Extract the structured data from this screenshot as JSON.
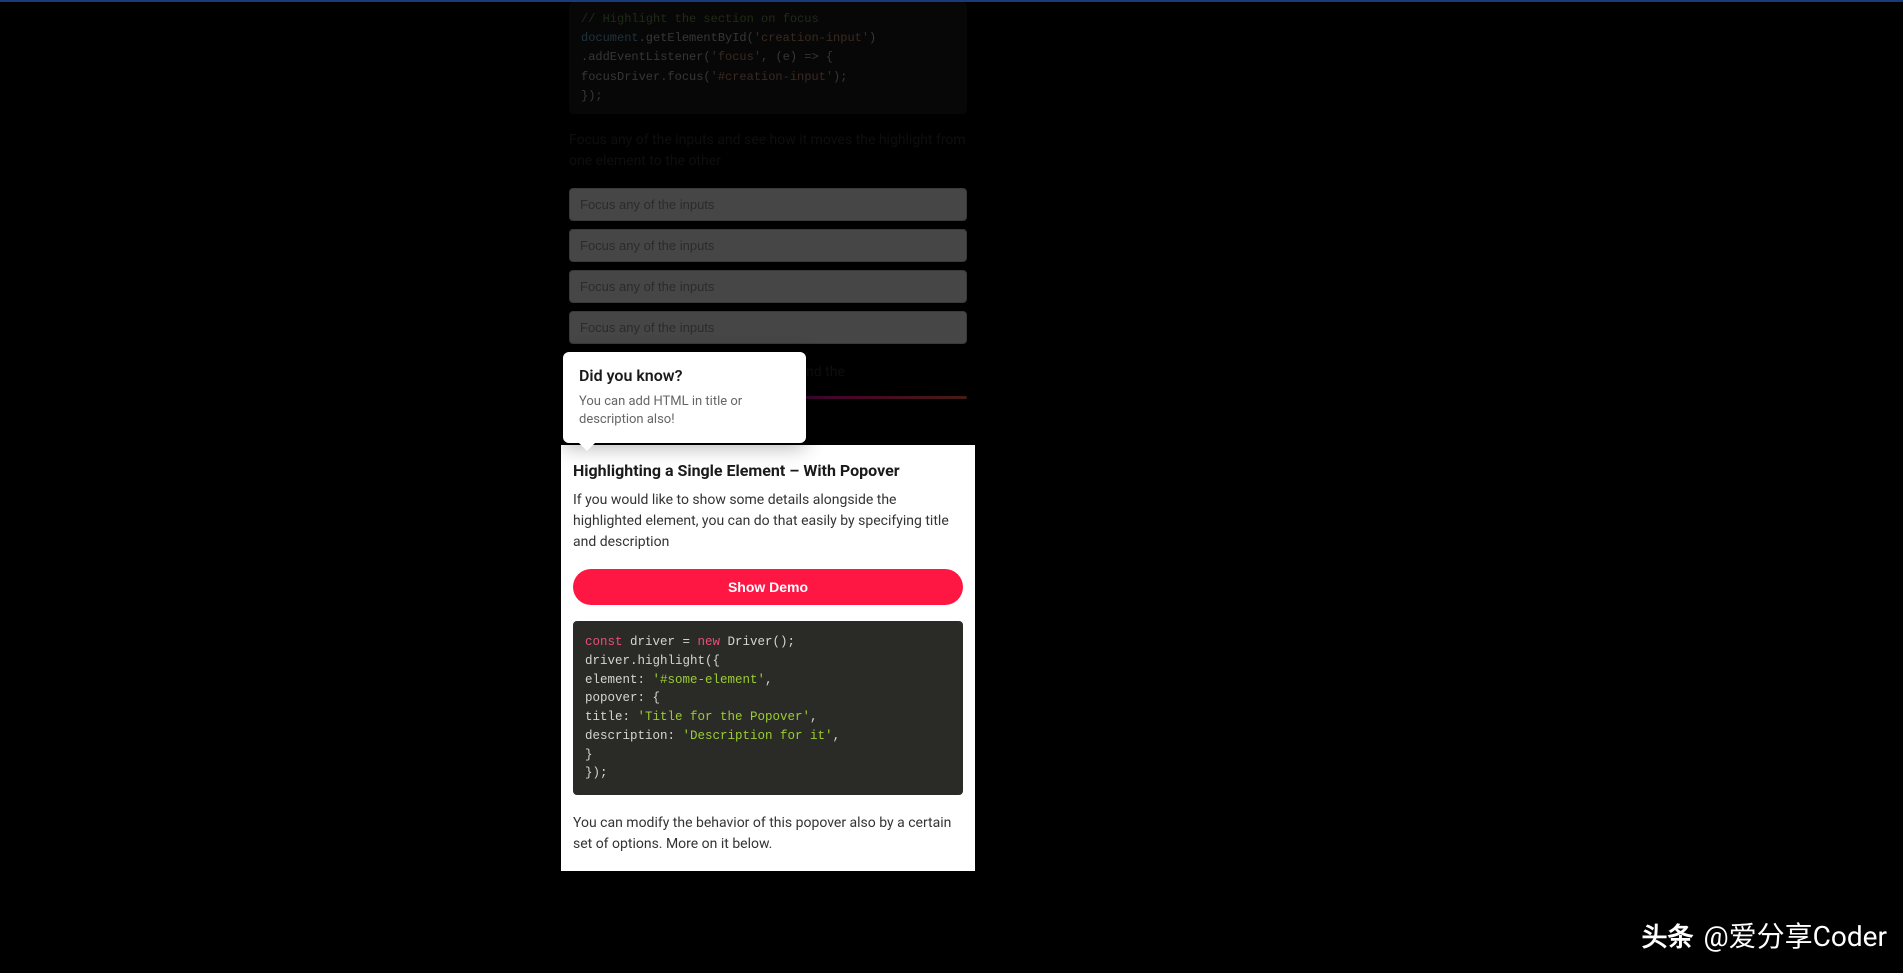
{
  "code_top": {
    "comment": "// Highlight the section on focus",
    "line1_part1": "document",
    "line1_part2": ".getElementById(",
    "line1_str": "'creation-input'",
    "line1_part3": ")",
    "line2_part1": "  .addEventListener(",
    "line2_str": "'focus'",
    "line2_part2": ", (e) => {",
    "line3_part1": "    focusDriver.focus(",
    "line3_str": "'#creation-input'",
    "line3_part2": ");",
    "line4": "  });"
  },
  "focus_description": "Focus any of the inputs and see how it moves the highlight from one element to the other",
  "input_placeholder": "Focus any of the inputs",
  "padding_note": "the padding around the",
  "popover": {
    "title": "Did you know?",
    "description": "You can add HTML in title or description also!"
  },
  "highlighted": {
    "heading": "Highlighting a Single Element – With Popover",
    "description": "If you would like to show some details alongside the highlighted element, you can do that easily by specifying title and description",
    "button_label": "Show Demo",
    "code": {
      "l1_const": "const",
      "l1_rest": " driver = ",
      "l1_new": "new",
      "l1_end": " Driver();",
      "l2": "driver.highlight({",
      "l3_key": "  element: ",
      "l3_str": "'#some-element'",
      "l3_end": ",",
      "l4": "  popover: {",
      "l5_key": "    title: ",
      "l5_str": "'Title for the Popover'",
      "l5_end": ",",
      "l6_key": "    description: ",
      "l6_str": "'Description for it'",
      "l6_end": ",",
      "l7": "  }",
      "l8": "});"
    },
    "bottom_note": "You can modify the behavior of this popover also by a certain set of options. More on it below."
  },
  "watermark": {
    "logo_text": "头条",
    "username": "@爱分享Coder"
  }
}
